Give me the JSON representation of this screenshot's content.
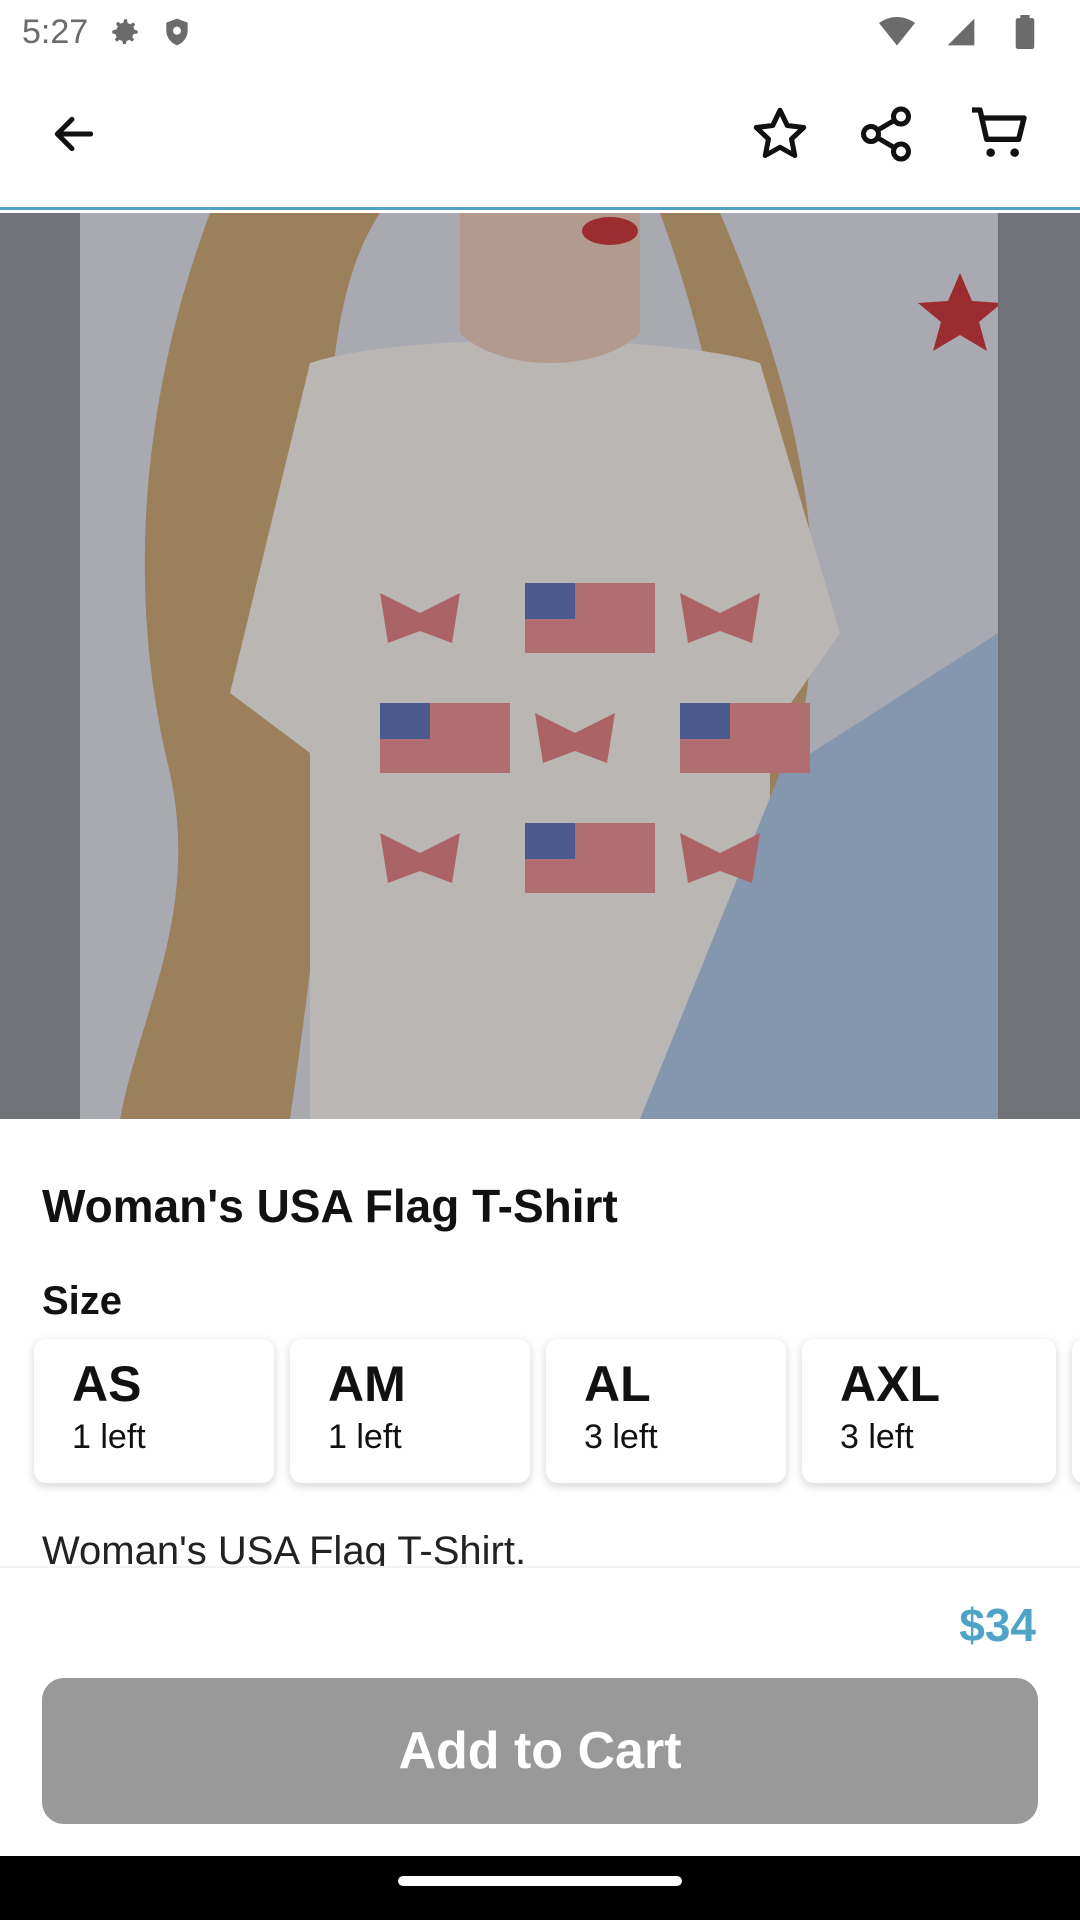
{
  "status_bar": {
    "time": "5:27",
    "icons": [
      "gear-icon",
      "shield-icon",
      "wifi-icon",
      "signal-icon",
      "battery-icon"
    ]
  },
  "app_bar": {
    "icons": [
      "back-arrow-icon",
      "star-icon",
      "share-icon",
      "cart-icon"
    ],
    "accent_color": "#4fa3c7"
  },
  "product": {
    "title": "Woman's USA Flag T-Shirt",
    "size_label": "Size",
    "sizes": [
      {
        "name": "AS",
        "stock": "1 left"
      },
      {
        "name": "AM",
        "stock": "1 left"
      },
      {
        "name": "AL",
        "stock": "3 left"
      },
      {
        "name": "AXL",
        "stock": "3 left"
      }
    ],
    "description": "Woman's USA Flag T-Shirt.",
    "price": "$34",
    "price_color": "#4fa3c7"
  },
  "actions": {
    "add_to_cart_label": "Add to Cart",
    "button_color": "#999999"
  }
}
